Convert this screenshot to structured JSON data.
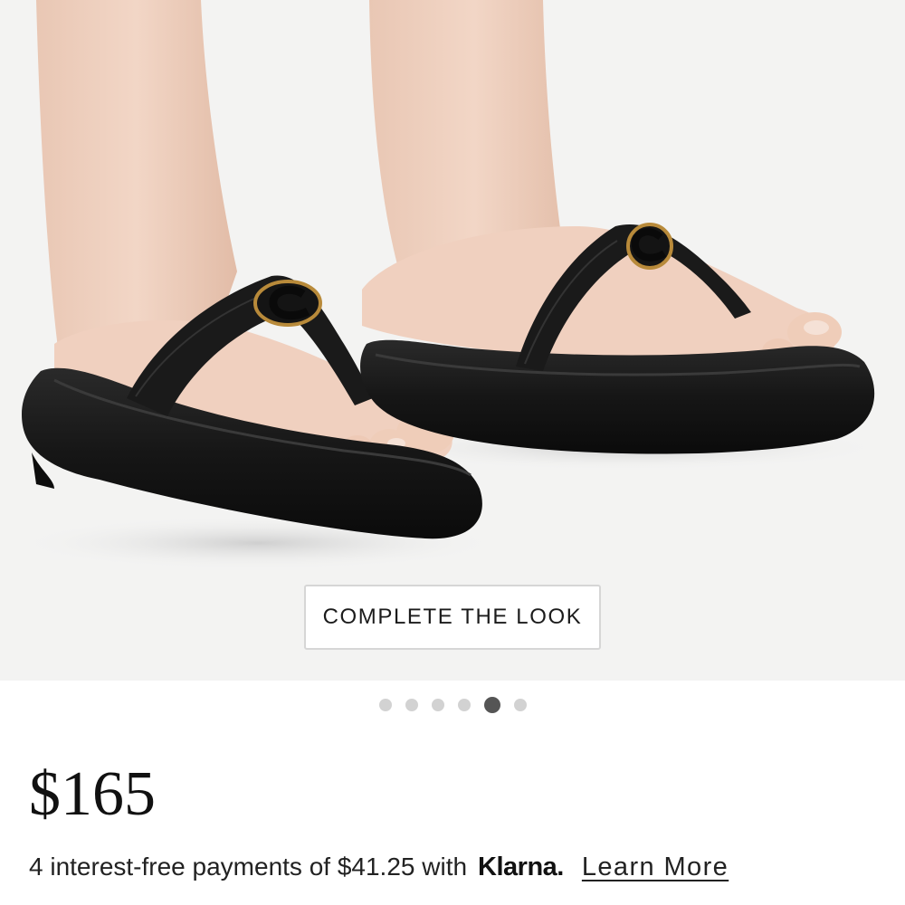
{
  "product": {
    "image_alt": "Black leather platform thong sandals with gold-rimmed C logo, worn on feet",
    "image_icon": "sandals-photo",
    "complete_look_label": "COMPLETE THE LOOK",
    "carousel": {
      "total": 6,
      "active_index": 5
    },
    "price": "$165",
    "payment": {
      "text": "4 interest-free payments of $41.25 with",
      "provider": "Klarna.",
      "learn_more_label": "Learn More"
    }
  },
  "colors": {
    "background": "#ffffff",
    "hero_background": "#f3f3f2",
    "sandal": "#141414",
    "logo_accent": "#b88a3a",
    "dot_inactive": "#d2d2d2",
    "dot_active": "#555555"
  }
}
